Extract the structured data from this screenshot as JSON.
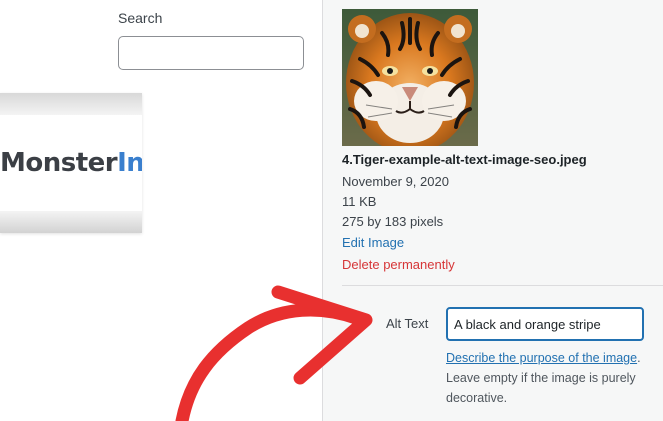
{
  "search": {
    "label": "Search",
    "value": ""
  },
  "logo": {
    "part1": "Monster",
    "part2": "Ins"
  },
  "attachment": {
    "filename": "4.Tiger-example-alt-text-image-seo.jpeg",
    "date": "November 9, 2020",
    "size": "11 KB",
    "dimensions": "275 by 183 pixels",
    "edit_link": "Edit Image",
    "delete_link": "Delete permanently"
  },
  "alt_text": {
    "label": "Alt Text",
    "value": "A black and orange stripe",
    "help_link": "Describe the purpose of the image",
    "help_rest": ". Leave empty if the image is purely decorative."
  },
  "colors": {
    "link": "#2271b1",
    "danger": "#d63638",
    "arrow": "#e8302f",
    "sidebar_bg": "#f6f7f7"
  },
  "icons": {
    "arrow": "curved-arrow-icon",
    "thumbnail": "tiger-image-icon"
  }
}
